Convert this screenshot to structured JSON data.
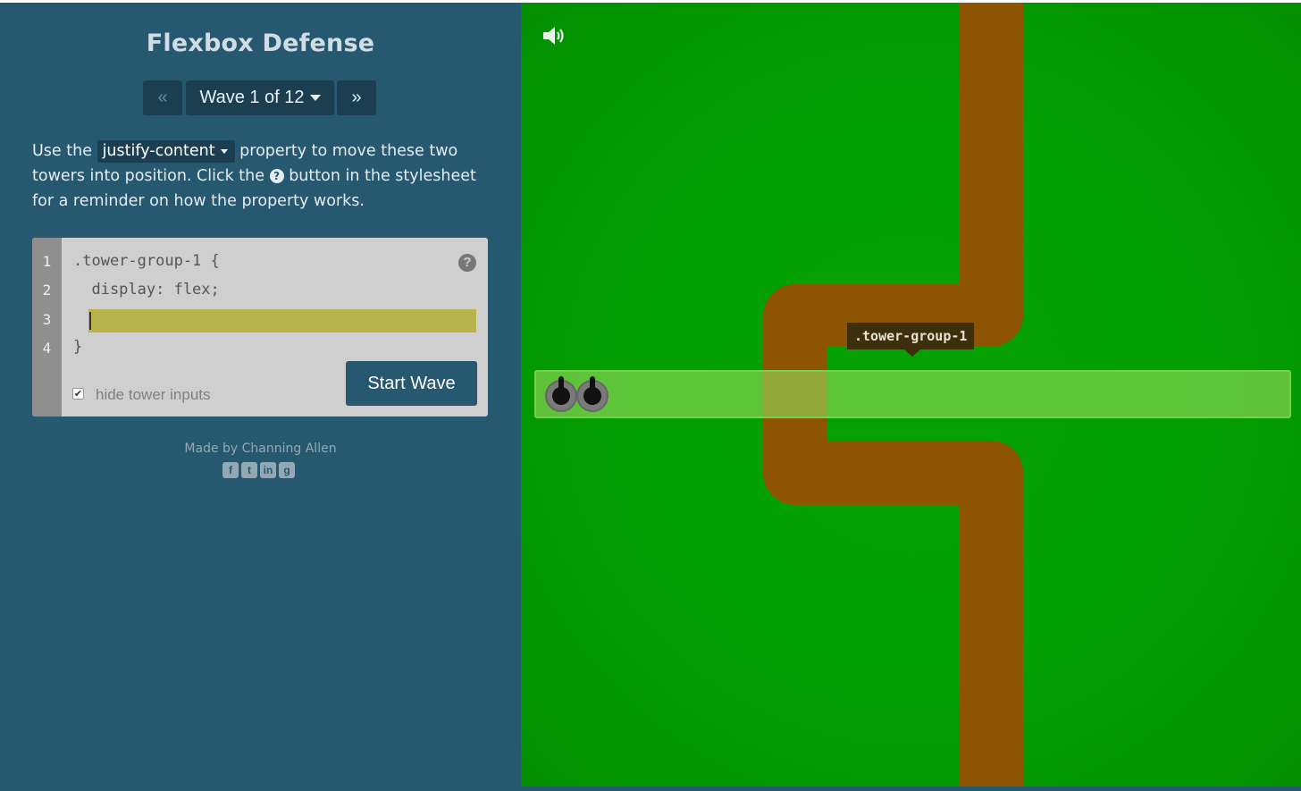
{
  "title": "Flexbox Defense",
  "nav": {
    "prev_label": "«",
    "wave_label": "Wave 1 of 12",
    "next_label": "»"
  },
  "instructions": {
    "part1": "Use the",
    "property": "justify-content",
    "part2": "property to move these two towers into position. Click the",
    "help_glyph": "?",
    "part3": "button in the stylesheet for a reminder on how the property works."
  },
  "editor": {
    "line_numbers": [
      "1",
      "2",
      "3",
      "4"
    ],
    "line1": ".tower-group-1 {",
    "line2": "  display: flex;",
    "input_value": "",
    "line4": "}",
    "help_label": "?",
    "start_label": "Start Wave",
    "hide_checked": true,
    "hide_label": "hide tower inputs"
  },
  "credit": {
    "text": "Made by Channing Allen",
    "social_icons": [
      "facebook-icon",
      "twitter-icon",
      "linkedin-icon",
      "github-icon"
    ]
  },
  "board": {
    "tooltip": ".tower-group-1",
    "tower_count": 2,
    "colors": {
      "grass": "#03a003",
      "path": "#8d5403",
      "tower_group_fill": "#96dc5a",
      "input_highlight": "#b7b34d"
    }
  }
}
